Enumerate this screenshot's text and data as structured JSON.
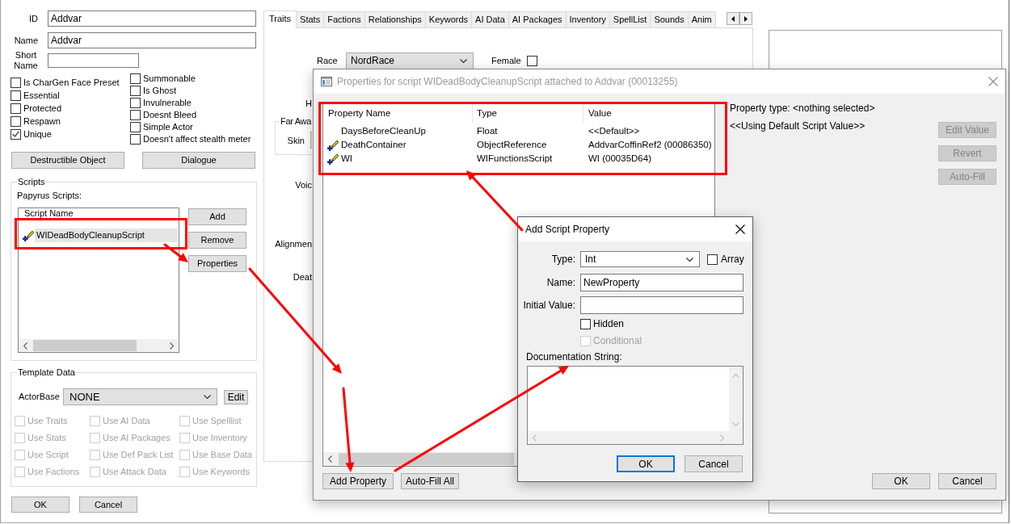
{
  "npc_window": {
    "fields": [
      {
        "label": "ID",
        "value": "Addvar"
      },
      {
        "label": "Name",
        "value": "Addvar"
      },
      {
        "label": "Short Name"
      }
    ],
    "flags_left": [
      {
        "label": "Is CharGen Face Preset",
        "checked": false
      },
      {
        "label": "Essential",
        "checked": false
      },
      {
        "label": "Protected",
        "checked": false
      },
      {
        "label": "Respawn",
        "checked": false
      },
      {
        "label": "Unique",
        "checked": true
      }
    ],
    "flags_right": [
      {
        "label": "Summonable",
        "checked": false
      },
      {
        "label": "Is Ghost",
        "checked": false
      },
      {
        "label": "Invulnerable",
        "checked": false
      },
      {
        "label": "Doesnt Bleed",
        "checked": false
      },
      {
        "label": "Simple Actor",
        "checked": false
      },
      {
        "label": "Doesn't affect stealth meter",
        "checked": false
      }
    ],
    "buttons": [
      "Destructible Object",
      "Dialogue"
    ],
    "scripts": {
      "title": "Scripts",
      "list_label": "Papyrus Scripts:",
      "column": "Script Name",
      "rows": [
        {
          "name": "WIDeadBodyCleanupScript",
          "selected": true
        }
      ],
      "buttons": [
        "Add",
        "Remove",
        "Properties"
      ]
    },
    "template_data": {
      "title": "Template Data",
      "actor_base_label": "ActorBase",
      "actor_base": "NONE",
      "edit_button": "Edit",
      "options": [
        {
          "label": "Use Traits",
          "checked": false,
          "disabled": true
        },
        {
          "label": "Use AI Data",
          "checked": false,
          "disabled": true
        },
        {
          "label": "Use Spelllist",
          "checked": false,
          "disabled": true
        },
        {
          "label": "Use Stats",
          "checked": false,
          "disabled": true
        },
        {
          "label": "Use AI Packages",
          "checked": false,
          "disabled": true
        },
        {
          "label": "Use Inventory",
          "checked": false,
          "disabled": true
        },
        {
          "label": "Use Script",
          "checked": false,
          "disabled": true
        },
        {
          "label": "Use Def Pack List",
          "checked": false,
          "disabled": true
        },
        {
          "label": "Use Base Data",
          "checked": false,
          "disabled": true
        },
        {
          "label": "Use Factions",
          "checked": false,
          "disabled": true
        },
        {
          "label": "Use Attack Data",
          "checked": false,
          "disabled": true
        },
        {
          "label": "Use Keywords",
          "checked": false,
          "disabled": true
        }
      ]
    },
    "footer_buttons": [
      "OK",
      "Cancel"
    ],
    "tabs": [
      {
        "label": "Traits",
        "selected": true
      },
      {
        "label": "Stats",
        "selected": false
      },
      {
        "label": "Factions",
        "selected": false
      },
      {
        "label": "Relationships",
        "selected": false
      },
      {
        "label": "Keywords",
        "selected": false
      },
      {
        "label": "AI Data",
        "selected": false
      },
      {
        "label": "AI Packages",
        "selected": false
      },
      {
        "label": "Inventory",
        "selected": false
      },
      {
        "label": "SpellList",
        "selected": false
      },
      {
        "label": "Sounds",
        "selected": false
      },
      {
        "label": "Anim",
        "selected": false
      }
    ],
    "traits_tab": {
      "race_label": "Race",
      "race": "NordRace",
      "female": {
        "label": "Female",
        "checked": false
      },
      "labels": [
        {
          "kind": "label",
          "text": "H"
        },
        {
          "kind": "group",
          "text": "Far Awa",
          "items": [
            {
              "kind": "dropdown_label",
              "text": "Skin"
            }
          ]
        },
        {
          "kind": "label",
          "text": "Voic"
        },
        {
          "kind": "label",
          "text": "Alignmen"
        },
        {
          "kind": "label",
          "text": "Deat"
        }
      ]
    }
  },
  "properties_dialog": {
    "title": "Properties for script WIDeadBodyCleanupScript attached to Addvar (00013255)",
    "active": false,
    "columns": [
      "Property Name",
      "Type",
      "Value"
    ],
    "rows": [
      {
        "name": "DaysBeforeCleanUp",
        "type": "Float",
        "value": "<<Default>>",
        "has_icon": false,
        "selected": false
      },
      {
        "name": "DeathContainer",
        "type": "ObjectReference",
        "value": "AddvarCoffinRef2 (00086350)",
        "has_icon": true,
        "selected": false
      },
      {
        "name": "WI",
        "type": "WIFunctionsScript",
        "value": "WI (00035D64)",
        "has_icon": true,
        "selected": false
      }
    ],
    "property_type": "Property type: <nothing selected>",
    "value_note": "<<Using Default Script Value>>",
    "side_buttons": [
      {
        "label": "Edit Value",
        "disabled": true
      },
      {
        "label": "Revert",
        "disabled": true
      },
      {
        "label": "Auto-Fill",
        "disabled": true
      }
    ],
    "list_buttons": [
      "Add Property",
      "Auto-Fill All"
    ],
    "footer_buttons": [
      "OK",
      "Cancel"
    ]
  },
  "add_property_dialog": {
    "title": "Add Script Property",
    "active": true,
    "type_label": "Type:",
    "type": "Int",
    "array": {
      "label": "Array",
      "checked": false
    },
    "name_label": "Name:",
    "name": "NewProperty",
    "initial_value_label": "Initial Value:",
    "options": [
      {
        "label": "Hidden",
        "checked": false,
        "disabled": false
      },
      {
        "label": "Conditional",
        "checked": false,
        "disabled": true
      }
    ],
    "doc_label": "Documentation String:",
    "buttons": [
      {
        "label": "OK",
        "default": true
      },
      {
        "label": "Cancel",
        "default": false
      }
    ]
  },
  "annotations": [
    {
      "kind": "box"
    },
    {
      "kind": "box"
    },
    {
      "kind": "arrow"
    },
    {
      "kind": "arrow"
    },
    {
      "kind": "arrow"
    },
    {
      "kind": "arrow"
    },
    {
      "kind": "arrow"
    }
  ]
}
